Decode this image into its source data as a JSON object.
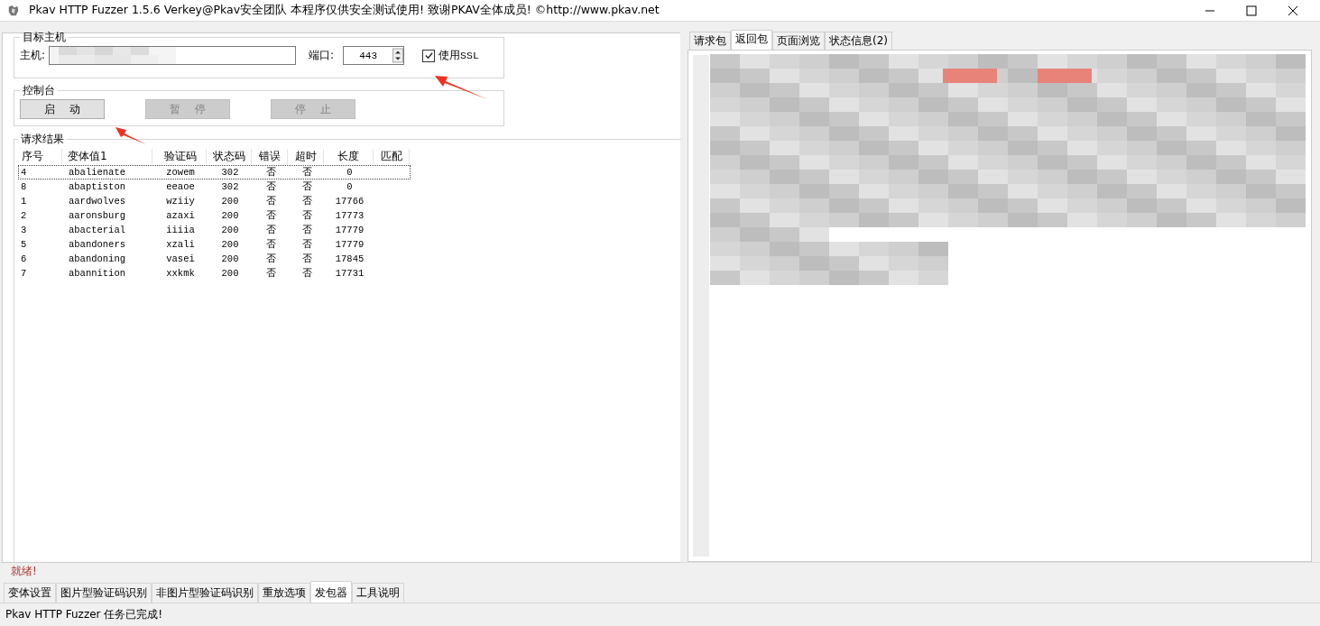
{
  "window": {
    "title": "Pkav HTTP Fuzzer 1.5.6  Verkey@Pkav安全团队  本程序仅供安全测试使用!  致谢PKAV全体成员! ©http://www.pkav.net"
  },
  "target": {
    "title": "目标主机",
    "host_label": "主机:",
    "port_label": "端口:",
    "port": "443",
    "ssl_label": "使用SSL",
    "ssl_checked": true
  },
  "console": {
    "title": "控制台",
    "buttons": [
      {
        "label": "启    动",
        "disabled": false
      },
      {
        "label": "暂    停",
        "disabled": true
      },
      {
        "label": "停    止",
        "disabled": true
      }
    ]
  },
  "results": {
    "title": "请求结果",
    "columns": [
      "序号",
      "变体值1",
      "验证码",
      "状态码",
      "错误",
      "超时",
      "长度",
      "匹配"
    ],
    "rows": [
      {
        "cells": [
          "4",
          "abalienate",
          "zowem",
          "302",
          "否",
          "否",
          "0"
        ],
        "selected": true
      },
      {
        "cells": [
          "8",
          "abaptiston",
          "eeaoe",
          "302",
          "否",
          "否",
          "0"
        ],
        "selected": false
      },
      {
        "cells": [
          "1",
          "aardwolves",
          "wziiy",
          "200",
          "否",
          "否",
          "17766"
        ],
        "selected": false
      },
      {
        "cells": [
          "2",
          "aaronsburg",
          "azaxi",
          "200",
          "否",
          "否",
          "17773"
        ],
        "selected": false
      },
      {
        "cells": [
          "3",
          "abacterial",
          "iiiia",
          "200",
          "否",
          "否",
          "17779"
        ],
        "selected": false
      },
      {
        "cells": [
          "5",
          "abandoners",
          "xzali",
          "200",
          "否",
          "否",
          "17779"
        ],
        "selected": false
      },
      {
        "cells": [
          "6",
          "abandoning",
          "vasei",
          "200",
          "否",
          "否",
          "17845"
        ],
        "selected": false
      },
      {
        "cells": [
          "7",
          "abannition",
          "xxkmk",
          "200",
          "否",
          "否",
          "17731"
        ],
        "selected": false
      }
    ]
  },
  "response_tabs": [
    {
      "label": "请求包",
      "selected": false
    },
    {
      "label": "返回包",
      "selected": true
    },
    {
      "label": "页面浏览",
      "selected": false
    },
    {
      "label": "状态信息(2)",
      "selected": false
    }
  ],
  "status": "就绪!",
  "bottom_tabs": [
    {
      "label": "变体设置",
      "selected": false
    },
    {
      "label": "图片型验证码识别",
      "selected": false
    },
    {
      "label": "非图片型验证码识别",
      "selected": false
    },
    {
      "label": "重放选项",
      "selected": false
    },
    {
      "label": "发包器",
      "selected": true
    },
    {
      "label": "工具说明",
      "selected": false
    }
  ],
  "status_bar": "Pkav HTTP Fuzzer 任务已完成!"
}
